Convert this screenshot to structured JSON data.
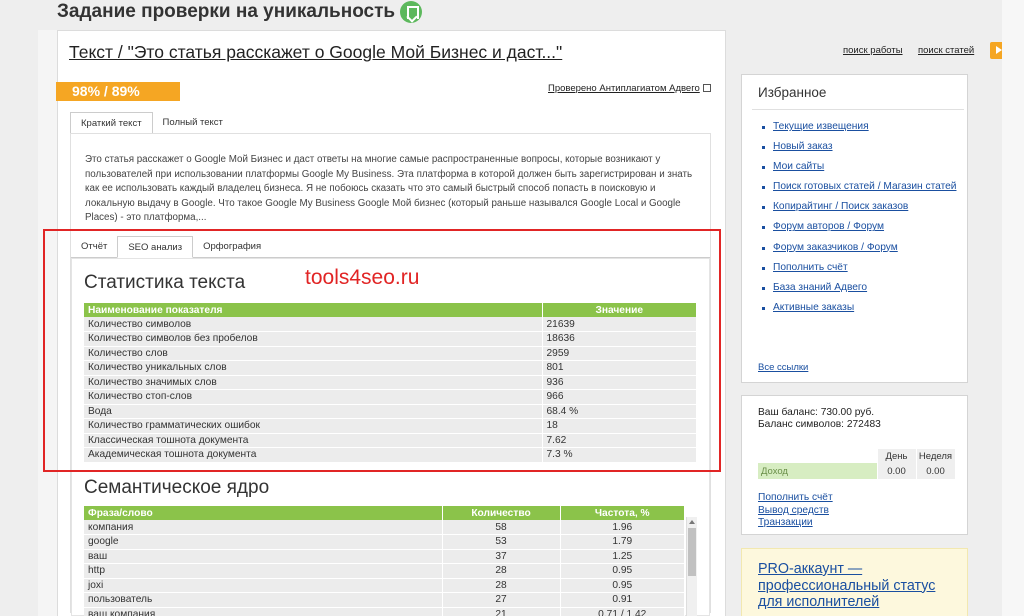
{
  "page": {
    "title": "Задание проверки на уникальность",
    "article_link": "Текст / \"Это статья расскажет о Google Мой Бизнес и даст...\"",
    "uniqueness_badge": "98% / 89%",
    "verify_link": "Проверено Антиплагиатом Адвего"
  },
  "text_tabs": [
    "Краткий текст",
    "Полный текст"
  ],
  "preview_text": "Это статья расскажет о Google Мой Бизнес и даст ответы на многие самые распространенные вопросы, которые возникают у пользователей при использовании платформы Google My Business. Эта платформа в которой должен быть зарегистрирован и знать как ее использовать каждый владелец бизнеса. Я не побоюсь сказать что это самый быстрый способ попасть в поисковую и локальную выдачу в Google. Что такое Google My Business Google Мой бизнес (который раньше назывался Google Local и Google Places) - это платформа,...",
  "report_tabs": [
    "Отчёт",
    "SEO анализ",
    "Орфография"
  ],
  "watermark": "tools4seo.ru",
  "stats": {
    "heading": "Статистика текста",
    "headers": [
      "Наименование показателя",
      "Значение"
    ],
    "rows": [
      [
        "Количество символов",
        "21639"
      ],
      [
        "Количество символов без пробелов",
        "18636"
      ],
      [
        "Количество слов",
        "2959"
      ],
      [
        "Количество уникальных слов",
        "801"
      ],
      [
        "Количество значимых слов",
        "936"
      ],
      [
        "Количество стоп-слов",
        "966"
      ],
      [
        "Вода",
        "68.4 %"
      ],
      [
        "Количество грамматических ошибок",
        "18"
      ],
      [
        "Классическая тошнота документа",
        "7.62"
      ],
      [
        "Академическая тошнота документа",
        "7.3 %"
      ]
    ]
  },
  "semantic": {
    "heading": "Семантическое ядро",
    "headers": [
      "Фраза/слово",
      "Количество",
      "Частота, %"
    ],
    "rows": [
      [
        "компания",
        "58",
        "1.96"
      ],
      [
        "google",
        "53",
        "1.79"
      ],
      [
        "ваш",
        "37",
        "1.25"
      ],
      [
        "http",
        "28",
        "0.95"
      ],
      [
        "joxi",
        "28",
        "0.95"
      ],
      [
        "пользователь",
        "27",
        "0.91"
      ],
      [
        "ваш компания",
        "21",
        "0.71 / 1.42"
      ]
    ]
  },
  "top_links": [
    "поиск работы",
    "поиск статей"
  ],
  "favorites": {
    "title": "Избранное",
    "items": [
      "Текущие извещения",
      "Новый заказ",
      "Мои сайты",
      "Поиск готовых статей / Магазин статей",
      "Копирайтинг / Поиск заказов",
      "Форум авторов / Форум",
      "Форум заказчиков / Форум",
      "Пополнить счёт",
      "База знаний Адвего",
      "Активные заказы"
    ],
    "all_links": "Все ссылки"
  },
  "balance": {
    "balance_line": "Ваш баланс: 730.00 руб.",
    "symbols_line": "Баланс символов: 272483",
    "col_day": "День",
    "col_week": "Неделя",
    "row_label": "Доход",
    "day_value": "0.00",
    "week_value": "0.00",
    "links": [
      "Пополнить счёт",
      "Вывод средств",
      "Транзакции"
    ]
  },
  "pro": {
    "text": "PRO-аккаунт — профессиональный статус для исполнителей"
  }
}
